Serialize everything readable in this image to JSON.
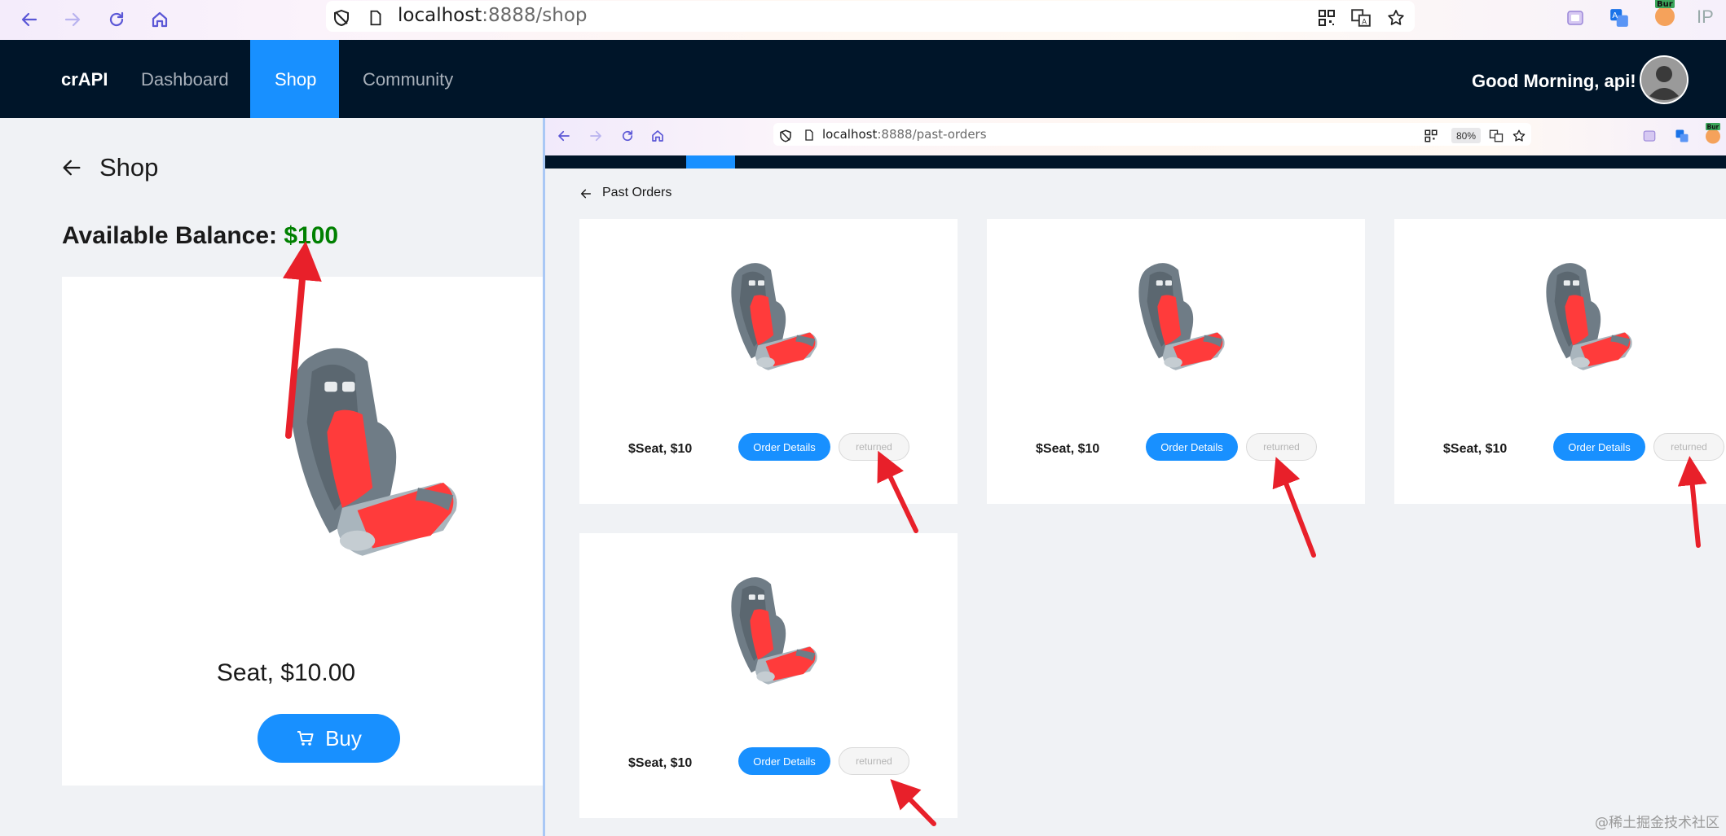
{
  "browser": {
    "url_host": "localhost",
    "url_rest": ":8888/shop",
    "toolbar_icons": [
      "back-icon",
      "forward-icon",
      "reload-icon",
      "home-icon",
      "tracking-shield-icon",
      "page-icon",
      "qr-code-icon",
      "translate-icon",
      "star-icon",
      "extension-icon",
      "translate-extension-icon",
      "burp-extension-icon"
    ],
    "extension_badge": "Bur",
    "edge_text": "IP"
  },
  "navbar": {
    "brand": "crAPI",
    "items": [
      {
        "label": "Dashboard",
        "active": false
      },
      {
        "label": "Shop",
        "active": true
      },
      {
        "label": "Community",
        "active": false
      }
    ],
    "greeting": "Good Morning, api!"
  },
  "shop": {
    "title": "Shop",
    "balance_label": "Available Balance:",
    "balance_value": "$100",
    "product": {
      "name": "Seat, $10.00",
      "buy_label": "Buy"
    }
  },
  "inner_window": {
    "url_host": "localhost",
    "url_rest": ":8888/past-orders",
    "zoom": "80%",
    "extension_badge": "Bur",
    "page_title": "Past Orders",
    "orders": [
      {
        "label": "$Seat, $10",
        "details_label": "Order Details",
        "status": "returned"
      },
      {
        "label": "$Seat, $10",
        "details_label": "Order Details",
        "status": "returned"
      },
      {
        "label": "$Seat, $10",
        "details_label": "Order Details",
        "status": "returned"
      },
      {
        "label": "$Seat, $10",
        "details_label": "Order Details",
        "status": "returned"
      }
    ]
  },
  "annotation_color": "#e8202a",
  "watermark": "@稀土掘金技术社区"
}
